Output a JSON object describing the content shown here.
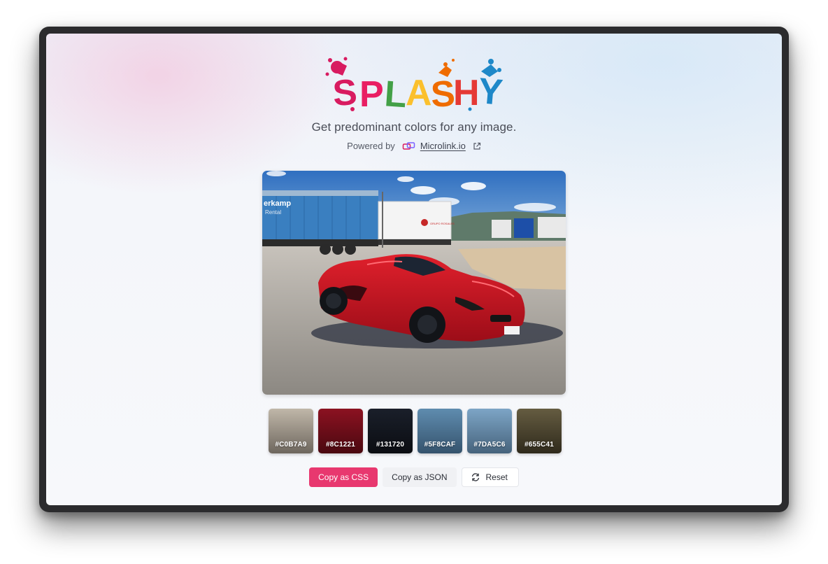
{
  "app": {
    "logo_text": "SPLASHY",
    "tagline": "Get predominant colors for any image.",
    "powered_by_label": "Powered by",
    "powered_by_link": "Microlink.io",
    "icons": {
      "microlink": "microlink-logo-icon",
      "external": "external-link-icon",
      "reset": "refresh-icon"
    }
  },
  "image": {
    "trailer_text_1": "erkamp",
    "trailer_text_2": "Rental",
    "trailer_text_3": "GRUPO ROSALES"
  },
  "palette": [
    {
      "hex": "#C0B7A9",
      "color": "#c0b7a9",
      "dark": "#6e675e"
    },
    {
      "hex": "#8C1221",
      "color": "#8c1221",
      "dark": "#4a0810"
    },
    {
      "hex": "#131720",
      "color": "#1a1f2a",
      "dark": "#0b0d12"
    },
    {
      "hex": "#5F8CAF",
      "color": "#5f8caf",
      "dark": "#35536d"
    },
    {
      "hex": "#7DA5C6",
      "color": "#7da5c6",
      "dark": "#46637c"
    },
    {
      "hex": "#655C41",
      "color": "#655c41",
      "dark": "#2f2a1c"
    }
  ],
  "actions": {
    "copy_css": "Copy as CSS",
    "copy_json": "Copy as JSON",
    "reset": "Reset"
  },
  "colors": {
    "primary": "#e8386f",
    "logo_s": "#d81b60",
    "logo_p": "#e91e63",
    "logo_l": "#43a047",
    "logo_a": "#fbc02d",
    "logo_s2": "#ef6c00",
    "logo_h": "#e53935",
    "logo_y": "#1e88c8"
  }
}
